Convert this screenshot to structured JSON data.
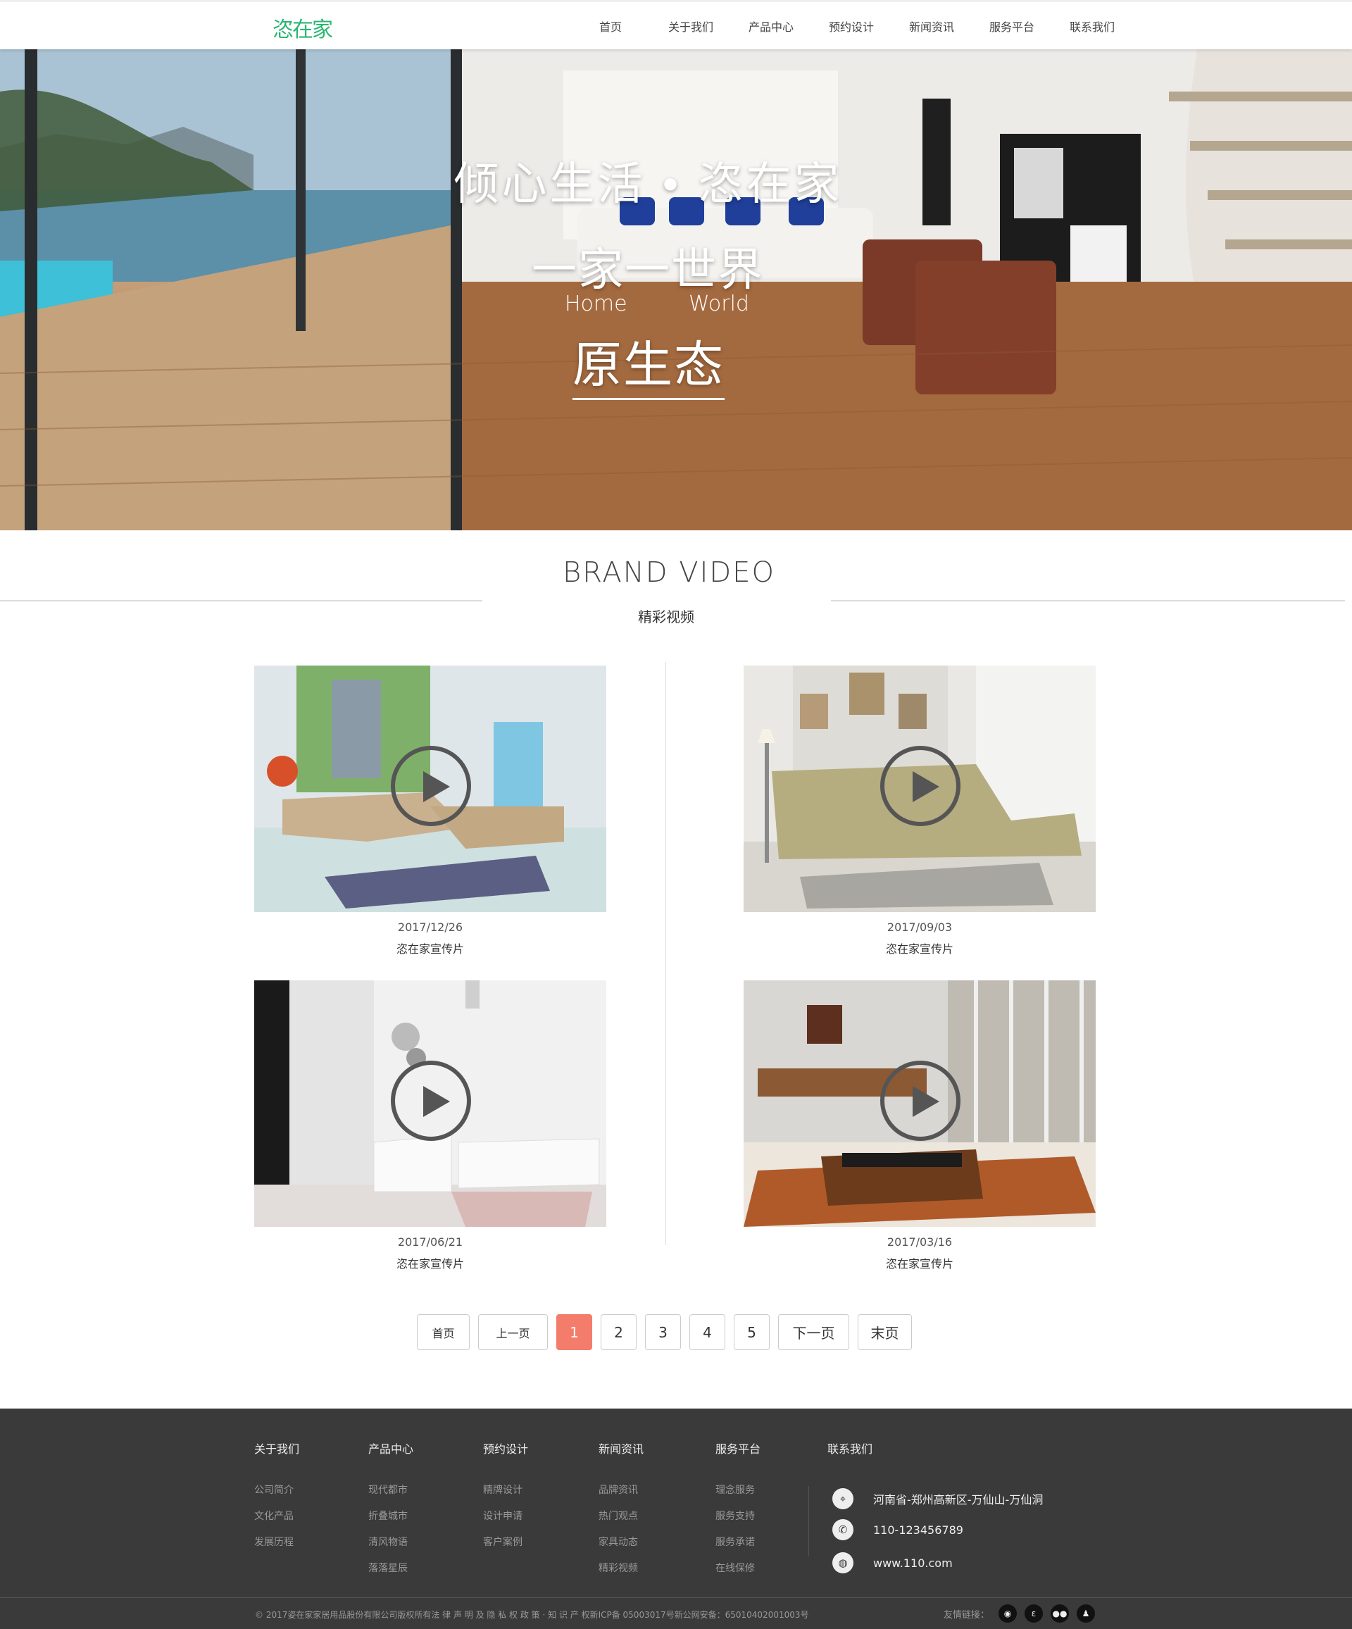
{
  "header": {
    "logo": "恣在家",
    "nav": [
      "首页",
      "关于我们",
      "产品中心",
      "预约设计",
      "新闻资讯",
      "服务平台",
      "联系我们"
    ]
  },
  "hero": {
    "line1": "倾心生活 • 恣在家",
    "line2": "一家一世界",
    "en_left": "Home",
    "en_right": "World",
    "line3": "原生态"
  },
  "section": {
    "title": "BRAND VIDEO",
    "subtitle": "精彩视频"
  },
  "videos": [
    {
      "date": "2017/12/26",
      "title": "恣在家宣传片"
    },
    {
      "date": "2017/09/03",
      "title": "恣在家宣传片"
    },
    {
      "date": "2017/06/21",
      "title": "恣在家宣传片"
    },
    {
      "date": "2017/03/16",
      "title": "恣在家宣传片"
    }
  ],
  "pager": {
    "first": "首页",
    "prev": "上一页",
    "pages": [
      "1",
      "2",
      "3",
      "4",
      "5"
    ],
    "current": "1",
    "next": "下一页",
    "last": "末页"
  },
  "footer": {
    "columns": [
      {
        "heading": "关于我们",
        "items": [
          "公司简介",
          "文化产品",
          "发展历程"
        ]
      },
      {
        "heading": "产品中心",
        "items": [
          "现代都市",
          "折叠城市",
          "清风物语",
          "落落星辰"
        ]
      },
      {
        "heading": "预约设计",
        "items": [
          "精牌设计",
          "设计申请",
          "客户案例"
        ]
      },
      {
        "heading": "新闻资讯",
        "items": [
          "品牌资讯",
          "热门观点",
          "家具动态",
          "精彩视频"
        ]
      },
      {
        "heading": "服务平台",
        "items": [
          "理念服务",
          "服务支持",
          "服务承诺",
          "在线保修"
        ]
      }
    ],
    "contact_heading": "联系我们",
    "address": "河南省-郑州高新区-万仙山-万仙洞",
    "phone": "110-123456789",
    "website": "www.110.com",
    "copyright": "© 2017姿在家家居用品股份有限公司版权所有法 律 声 明 及 隐 私 权 政 策 · 知 识 产 权新ICP备 05003017号新公网安备：65010402001003号",
    "friend_label": "友情链接：",
    "socials": [
      "weibo-icon",
      "tencent-weibo-icon",
      "wechat-icon",
      "qq-icon"
    ]
  },
  "colors": {
    "accent": "#2bb673",
    "pager_active": "#f47c6b",
    "footer_bg": "#3a3a3a"
  }
}
